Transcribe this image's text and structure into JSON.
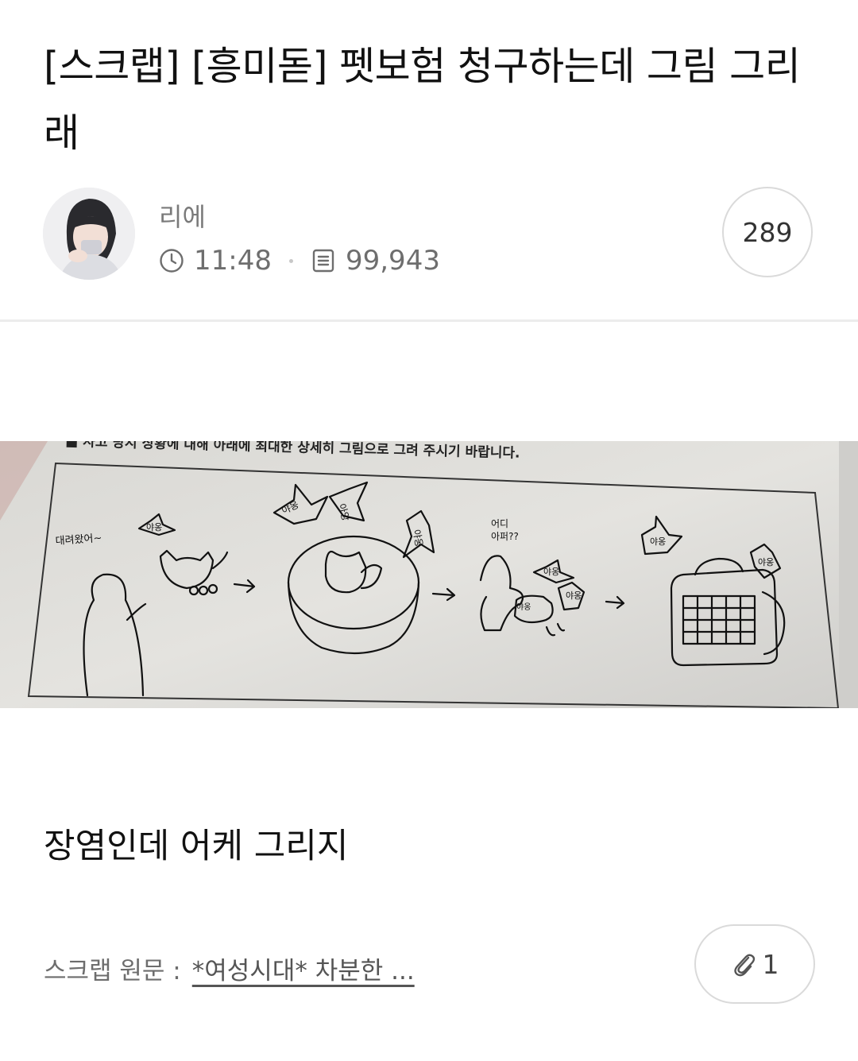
{
  "post": {
    "title": "[스크랩] [흥미돋] 펫보험 청구하는데 그림 그리래",
    "author": "리에",
    "time": "11:48",
    "views": "99,943",
    "comment_count": "289",
    "body_text": "장염인데 어케 그리지"
  },
  "image": {
    "form_instruction": "■ 사고 당시 상황에 대해 아래에 최대한 상세히 그림으로 그려 주시기 바랍니다.",
    "doodles": {
      "person_words": "대려왔어~",
      "star_sound_1": "야옹",
      "star_sound_2": "야옹",
      "star_sound_3": "아앙",
      "star_sound_4": "야옹",
      "question": "어디",
      "question_2": "아퍼??",
      "star_sound_5": "야옹",
      "star_sound_6": "야옹",
      "star_sound_7": "야옹",
      "star_sound_8": "야옹",
      "star_sound_9": "야옹"
    }
  },
  "footer": {
    "source_label": "스크랩 원문 :",
    "source_link": "*여성시대* 차분한 ...",
    "attachment_count": "1"
  },
  "icons": {
    "clock": "clock-icon",
    "doc": "document-icon",
    "attach": "paperclip-icon"
  },
  "colors": {
    "text": "#111111",
    "muted": "#6e6e6e",
    "border": "#dadada"
  }
}
